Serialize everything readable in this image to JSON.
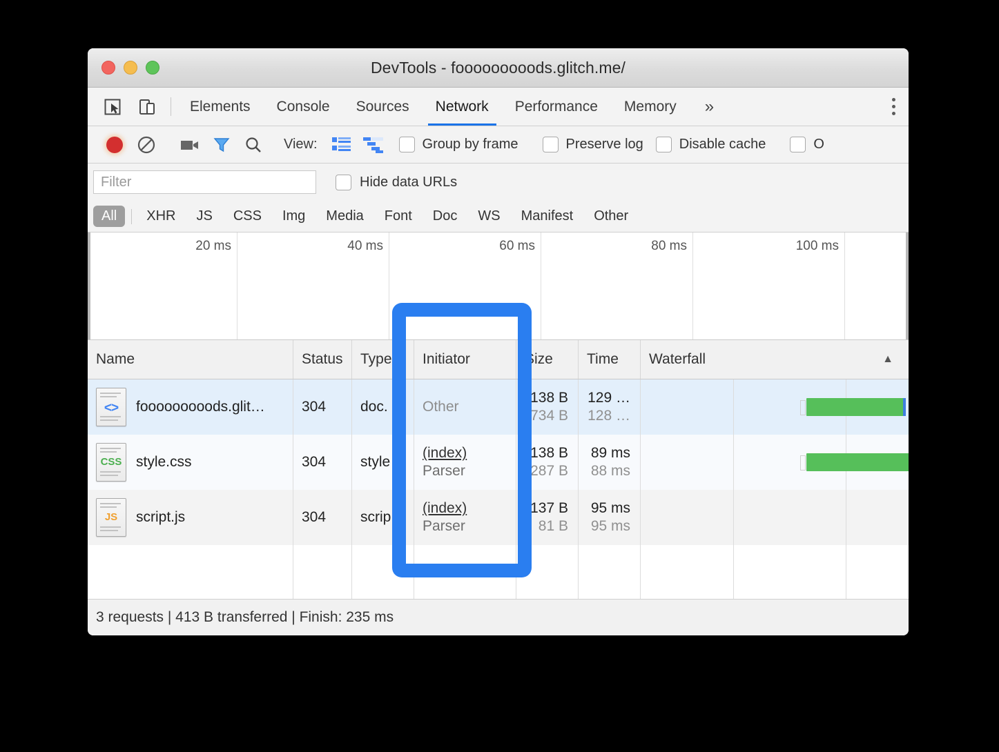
{
  "window": {
    "title": "DevTools - fooooooooods.glitch.me/",
    "traffic_lights": [
      "close",
      "minimize",
      "maximize"
    ]
  },
  "tabbar": {
    "inspect_icon": "cursor-select-icon",
    "device_icon": "device-toolbar-icon",
    "tabs": [
      {
        "label": "Elements",
        "active": false
      },
      {
        "label": "Console",
        "active": false
      },
      {
        "label": "Sources",
        "active": false
      },
      {
        "label": "Network",
        "active": true
      },
      {
        "label": "Performance",
        "active": false
      },
      {
        "label": "Memory",
        "active": false
      }
    ],
    "overflow_label": "»",
    "menu_icon": "kebab-menu-icon"
  },
  "network_toolbar": {
    "record_icon": "record-icon",
    "clear_icon": "clear-icon",
    "camera_icon": "screenshot-camera-icon",
    "filter_icon": "filter-funnel-icon",
    "search_icon": "search-icon",
    "view_label": "View:",
    "view_list_icon": "list-view-icon",
    "view_waterfall_icon": "waterfall-view-icon",
    "checkboxes": [
      {
        "label": "Group by frame",
        "checked": false
      },
      {
        "label": "Preserve log",
        "checked": false
      },
      {
        "label": "Disable cache",
        "checked": false
      },
      {
        "label": "O",
        "checked": false
      }
    ]
  },
  "filter_row": {
    "input_value": "",
    "input_placeholder": "Filter",
    "hide_data_urls_label": "Hide data URLs",
    "hide_data_urls_checked": false
  },
  "type_filters": {
    "all_label": "All",
    "items": [
      "XHR",
      "JS",
      "CSS",
      "Img",
      "Media",
      "Font",
      "Doc",
      "WS",
      "Manifest",
      "Other"
    ],
    "active": "All"
  },
  "overview": {
    "ticks": [
      "20 ms",
      "40 ms",
      "60 ms",
      "80 ms",
      "100 ms"
    ]
  },
  "table": {
    "columns": [
      "Name",
      "Status",
      "Type",
      "Initiator",
      "Size",
      "Time",
      "Waterfall"
    ],
    "sort_indicator": "▲",
    "rows": [
      {
        "icon": "document-file-icon",
        "icon_badge": "<>",
        "name": "fooooooooods.glit…",
        "status": "304",
        "type": "doc.",
        "initiator_link": "",
        "initiator_sub": "Other",
        "size_main": "138 B",
        "size_sub": "734 B",
        "time_main": "129 …",
        "time_sub": "128 …",
        "selected": true
      },
      {
        "icon": "css-file-icon",
        "icon_badge": "CSS",
        "name": "style.css",
        "status": "304",
        "type": "style",
        "initiator_link": "(index)",
        "initiator_sub": "Parser",
        "size_main": "138 B",
        "size_sub": "287 B",
        "time_main": "89 ms",
        "time_sub": "88 ms",
        "selected": false
      },
      {
        "icon": "js-file-icon",
        "icon_badge": "JS",
        "name": "script.js",
        "status": "304",
        "type": "scrip",
        "initiator_link": "(index)",
        "initiator_sub": "Parser",
        "size_main": "137 B",
        "size_sub": "81 B",
        "time_main": "95 ms",
        "time_sub": "95 ms",
        "selected": false
      }
    ]
  },
  "status_bar": {
    "text": "3 requests | 413 B transferred | Finish: 235 ms"
  },
  "annotation": {
    "name": "initiator-column-highlight",
    "color": "#2a7ef0"
  },
  "colors": {
    "accent_blue": "#1a73e8",
    "highlight_blue": "#2a7ef0",
    "waterfall_green": "#56bf5a",
    "selected_row": "#e3effb"
  }
}
